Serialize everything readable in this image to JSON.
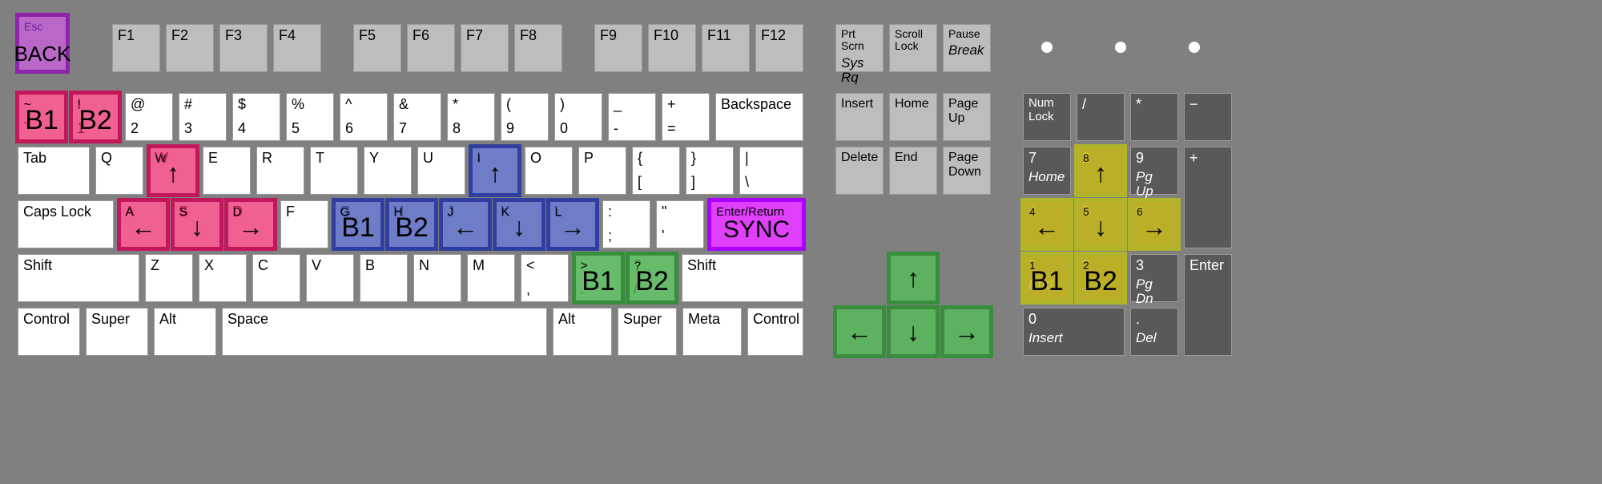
{
  "esc": {
    "small": "Esc",
    "big": "BACK"
  },
  "frow": [
    "F1",
    "F2",
    "F3",
    "F4",
    "F5",
    "F6",
    "F7",
    "F8",
    "F9",
    "F10",
    "F11",
    "F12"
  ],
  "prtscrn": {
    "top": "Prt Scrn",
    "sub": "Sys Rq"
  },
  "scrolllock": "Scroll Lock",
  "pause": {
    "top": "Pause",
    "sub": "Break"
  },
  "numrow": [
    {
      "t": "~",
      "b": "`"
    },
    {
      "t": "!",
      "b": "1"
    },
    {
      "t": "@",
      "b": "2"
    },
    {
      "t": "#",
      "b": "3"
    },
    {
      "t": "$",
      "b": "4"
    },
    {
      "t": "%",
      "b": "5"
    },
    {
      "t": "^",
      "b": "6"
    },
    {
      "t": "&",
      "b": "7"
    },
    {
      "t": "*",
      "b": "8"
    },
    {
      "t": "(",
      "b": "9"
    },
    {
      "t": ")",
      "b": "0"
    },
    {
      "t": "_",
      "b": "-"
    },
    {
      "t": "+",
      "b": "="
    }
  ],
  "backspace": "Backspace",
  "tab": "Tab",
  "qrow": [
    "Q",
    "W",
    "E",
    "R",
    "T",
    "Y",
    "U",
    "I",
    "O",
    "P"
  ],
  "qbrackets": [
    {
      "t": "{",
      "b": "["
    },
    {
      "t": "}",
      "b": "]"
    },
    {
      "t": "|",
      "b": "\\"
    }
  ],
  "caps": "Caps Lock",
  "arow": [
    "A",
    "S",
    "D",
    "F",
    "G",
    "H",
    "J",
    "K",
    "L"
  ],
  "apunct": [
    {
      "t": ":",
      "b": ";"
    },
    {
      "t": "\"",
      "b": "'"
    }
  ],
  "enter": {
    "top": "Enter/Return",
    "big": "SYNC"
  },
  "lshift": "Shift",
  "zrow": [
    "Z",
    "X",
    "C",
    "V",
    "B",
    "N",
    "M"
  ],
  "zpunct": [
    {
      "t": "<",
      "b": ","
    },
    {
      "t": ">",
      "b": "."
    },
    {
      "t": "?",
      "b": "/"
    }
  ],
  "rshift": "Shift",
  "bottomrow": [
    "Control",
    "Super",
    "Alt",
    "Space",
    "Alt",
    "Super",
    "Meta",
    "Control"
  ],
  "nav1": [
    "Insert",
    "Home",
    "Page Up"
  ],
  "nav2": [
    "Delete",
    "End",
    "Page Down"
  ],
  "arrows": {
    "up": "↑",
    "left": "←",
    "down": "↓",
    "right": "→"
  },
  "numpad": {
    "r0": [
      "Num Lock",
      "/",
      "*",
      "−"
    ],
    "r1": [
      {
        "t": "7",
        "s": "Home"
      },
      {
        "t": "8",
        "s": ""
      },
      {
        "t": "9",
        "s": "Pg Up"
      },
      {
        "t": "+",
        "s": ""
      }
    ],
    "r2": [
      {
        "t": "4",
        "s": ""
      },
      {
        "t": "5",
        "s": ""
      },
      {
        "t": "6",
        "s": ""
      }
    ],
    "r3": [
      {
        "t": "1",
        "s": "End"
      },
      {
        "t": "2",
        "s": ""
      },
      {
        "t": "3",
        "s": "Pg Dn"
      }
    ],
    "enter": "Enter",
    "r4": [
      {
        "t": "0",
        "s": "Insert"
      },
      {
        "t": ".",
        "s": "Del"
      }
    ]
  },
  "hl_labels": {
    "b1": "B1",
    "b2": "B2",
    "up": "↑",
    "down": "↓",
    "left": "←",
    "right": "→"
  }
}
